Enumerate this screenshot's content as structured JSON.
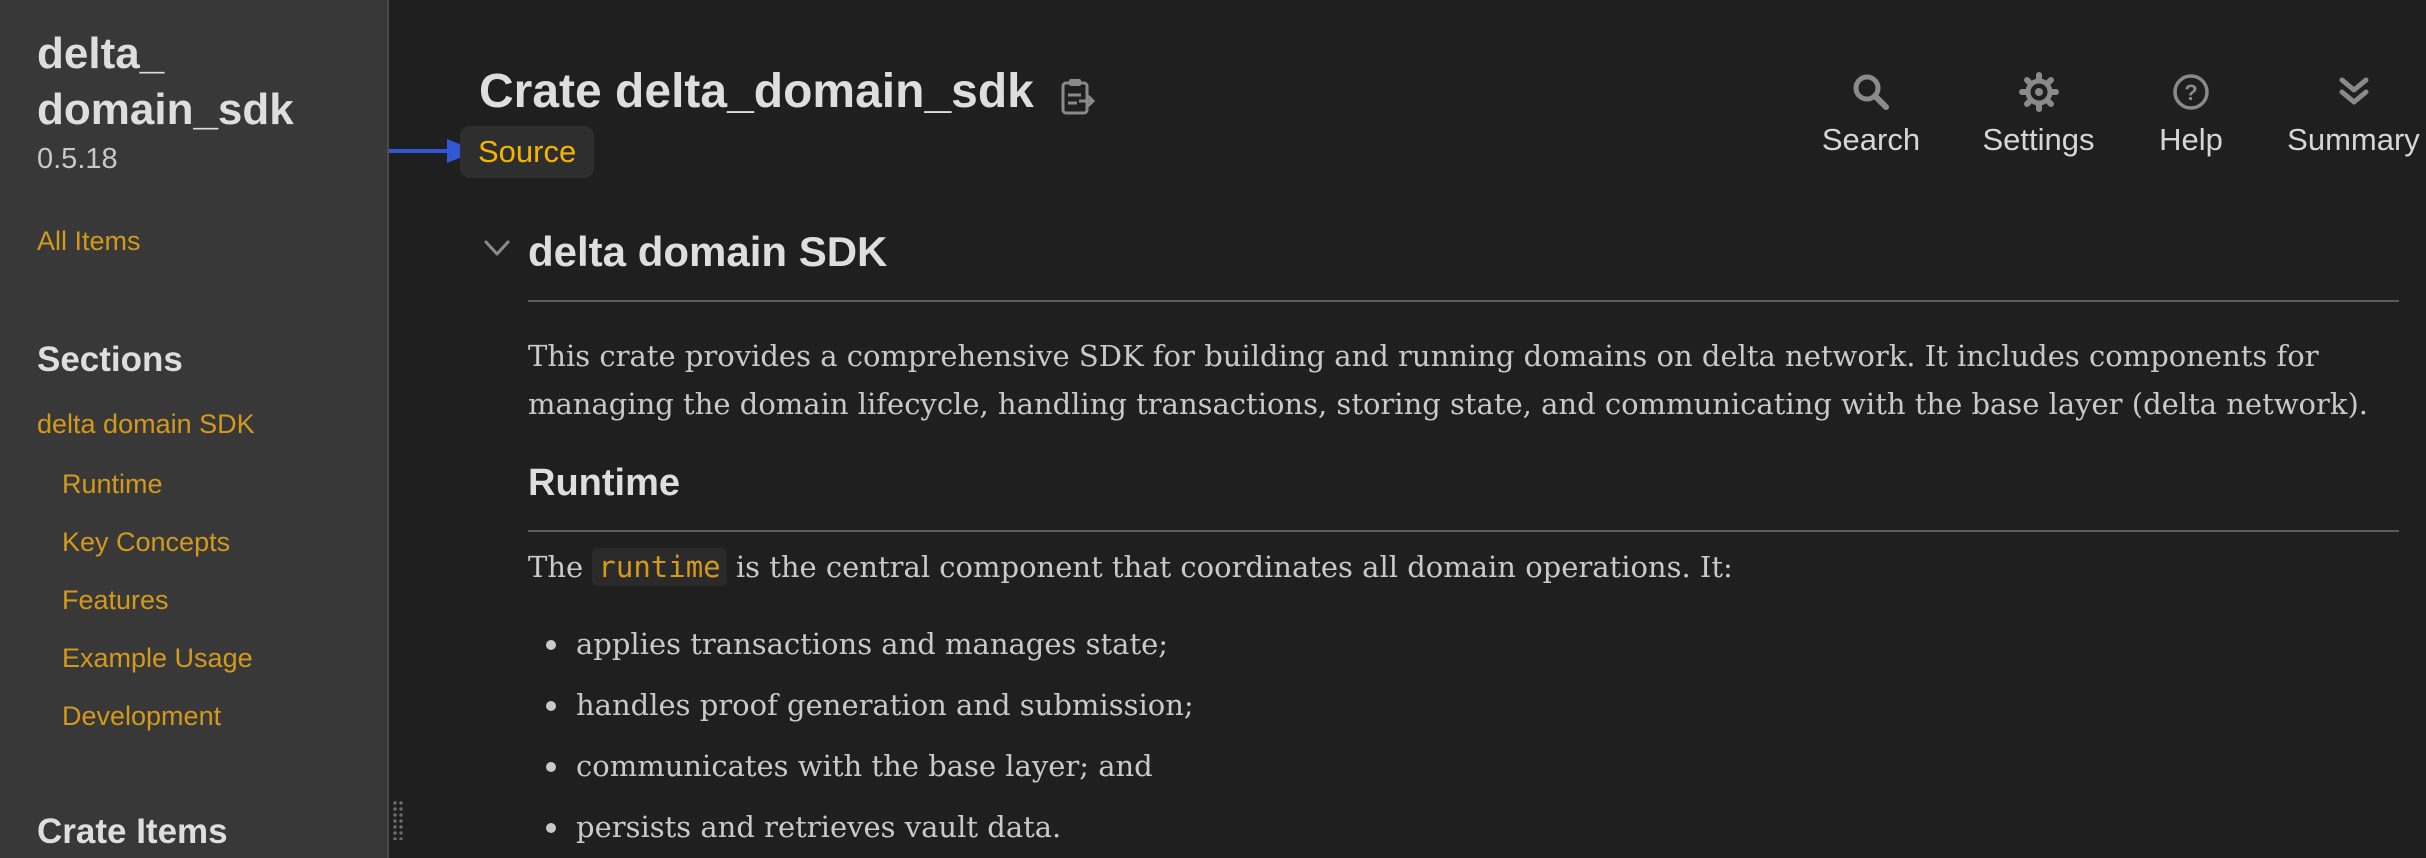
{
  "sidebar": {
    "crate_name": "delta_ domain_sdk",
    "version": "0.5.18",
    "all_items": "All Items",
    "sections_heading": "Sections",
    "sections": [
      {
        "label": "delta domain SDK"
      },
      {
        "label": "Runtime"
      },
      {
        "label": "Key Concepts"
      },
      {
        "label": "Features"
      },
      {
        "label": "Example Usage"
      },
      {
        "label": "Development"
      }
    ],
    "crate_items_heading": "Crate Items"
  },
  "header": {
    "title": "Crate delta_domain_sdk",
    "source_label": "Source",
    "tools": [
      {
        "label": "Search",
        "icon": "search-icon"
      },
      {
        "label": "Settings",
        "icon": "gear-icon"
      },
      {
        "label": "Help",
        "icon": "help-icon"
      },
      {
        "label": "Summary",
        "icon": "double-chevron-down-icon"
      }
    ]
  },
  "content": {
    "heading": "delta domain SDK",
    "intro": "This crate provides a comprehensive SDK for building and running domains on delta network. It includes components for managing the domain lifecycle, handling transactions, storing state, and communicating with the base layer (delta network).",
    "runtime_heading": "Runtime",
    "runtime_para_pre": "The",
    "runtime_code": "runtime",
    "runtime_para_post": "is the central component that coordinates all domain operations. It:",
    "bullets": [
      "applies transactions and manages state;",
      "handles proof generation and submission;",
      "communicates with the base layer; and",
      "persists and retrieves vault data."
    ]
  },
  "colors": {
    "link": "#d2991d",
    "source": "#f4b400",
    "arrow": "#2f57d6",
    "background": "#1f1f1f",
    "sidebar": "#383838"
  }
}
